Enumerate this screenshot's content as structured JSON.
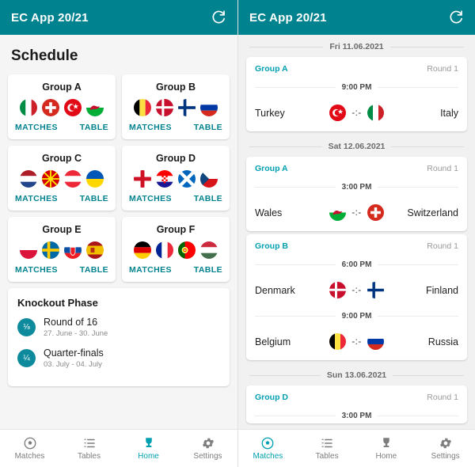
{
  "app": {
    "title": "EC App 20/21",
    "accent_color": "#00838f",
    "link_color": "#00a0b0",
    "refresh_icon": "refresh-icon"
  },
  "left_panel": {
    "page_title": "Schedule",
    "groups": [
      {
        "name": "Group A",
        "teams": [
          "Italy",
          "Switzerland",
          "Turkey",
          "Wales"
        ],
        "matches_label": "MATCHES",
        "table_label": "TABLE"
      },
      {
        "name": "Group B",
        "teams": [
          "Belgium",
          "Denmark",
          "Finland",
          "Russia"
        ],
        "matches_label": "MATCHES",
        "table_label": "TABLE"
      },
      {
        "name": "Group C",
        "teams": [
          "Netherlands",
          "North Macedonia",
          "Austria",
          "Ukraine"
        ],
        "matches_label": "MATCHES",
        "table_label": "TABLE"
      },
      {
        "name": "Group D",
        "teams": [
          "England",
          "Croatia",
          "Scotland",
          "Czech Republic"
        ],
        "matches_label": "MATCHES",
        "table_label": "TABLE"
      },
      {
        "name": "Group E",
        "teams": [
          "Poland",
          "Sweden",
          "Slovakia",
          "Spain"
        ],
        "matches_label": "MATCHES",
        "table_label": "TABLE"
      },
      {
        "name": "Group F",
        "teams": [
          "Germany",
          "France",
          "Portugal",
          "Hungary"
        ],
        "matches_label": "MATCHES",
        "table_label": "TABLE"
      }
    ],
    "knockout": {
      "title": "Knockout Phase",
      "rounds": [
        {
          "badge": "⅛",
          "name": "Round of 16",
          "dates": "27. June - 30. June"
        },
        {
          "badge": "¼",
          "name": "Quarter-finals",
          "dates": "03. July - 04. July"
        }
      ]
    },
    "nav": {
      "items": [
        {
          "label": "Matches",
          "icon": "soccer-ball-icon",
          "active": false
        },
        {
          "label": "Tables",
          "icon": "list-icon",
          "active": false
        },
        {
          "label": "Home",
          "icon": "trophy-icon",
          "active": true
        },
        {
          "label": "Settings",
          "icon": "gear-icon",
          "active": false
        }
      ]
    }
  },
  "right_panel": {
    "days": [
      {
        "date": "Fri 11.06.2021",
        "cards": [
          {
            "group": "Group A",
            "round": "Round 1",
            "matches": [
              {
                "time": "9:00 PM",
                "home": "Turkey",
                "away": "Italy",
                "score": "-:-"
              }
            ]
          }
        ]
      },
      {
        "date": "Sat 12.06.2021",
        "cards": [
          {
            "group": "Group A",
            "round": "Round 1",
            "matches": [
              {
                "time": "3:00 PM",
                "home": "Wales",
                "away": "Switzerland",
                "score": "-:-"
              }
            ]
          },
          {
            "group": "Group B",
            "round": "Round 1",
            "matches": [
              {
                "time": "6:00 PM",
                "home": "Denmark",
                "away": "Finland",
                "score": "-:-"
              },
              {
                "time": "9:00 PM",
                "home": "Belgium",
                "away": "Russia",
                "score": "-:-"
              }
            ]
          }
        ]
      },
      {
        "date": "Sun 13.06.2021",
        "cards": [
          {
            "group": "Group D",
            "round": "Round 1",
            "matches": [
              {
                "time": "3:00 PM",
                "home": "",
                "away": "",
                "score": ""
              }
            ]
          }
        ]
      }
    ],
    "nav": {
      "items": [
        {
          "label": "Matches",
          "icon": "soccer-ball-icon",
          "active": true
        },
        {
          "label": "Tables",
          "icon": "list-icon",
          "active": false
        },
        {
          "label": "Home",
          "icon": "trophy-icon",
          "active": false
        },
        {
          "label": "Settings",
          "icon": "gear-icon",
          "active": false
        }
      ]
    }
  }
}
